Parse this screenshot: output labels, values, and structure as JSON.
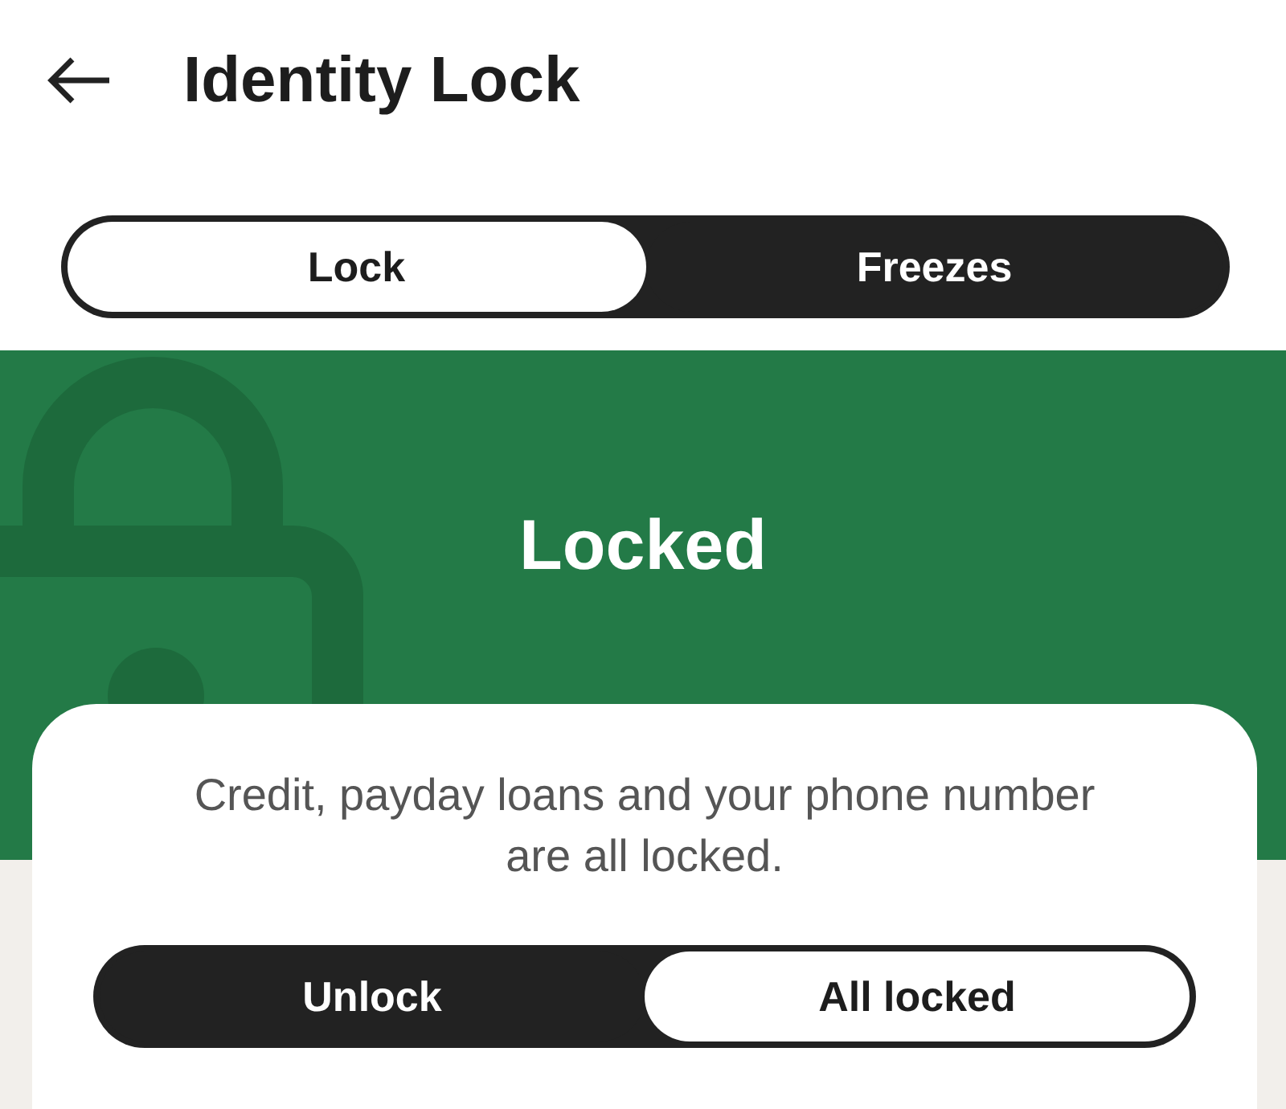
{
  "header": {
    "title": "Identity Lock"
  },
  "tabs": [
    {
      "label": "Lock",
      "selected": true
    },
    {
      "label": "Freezes",
      "selected": false
    }
  ],
  "status": {
    "title": "Locked"
  },
  "card": {
    "message": "Credit, payday loans and your phone number are all locked.",
    "toggle": [
      {
        "label": "Unlock",
        "selected": false
      },
      {
        "label": "All locked",
        "selected": true
      }
    ]
  }
}
